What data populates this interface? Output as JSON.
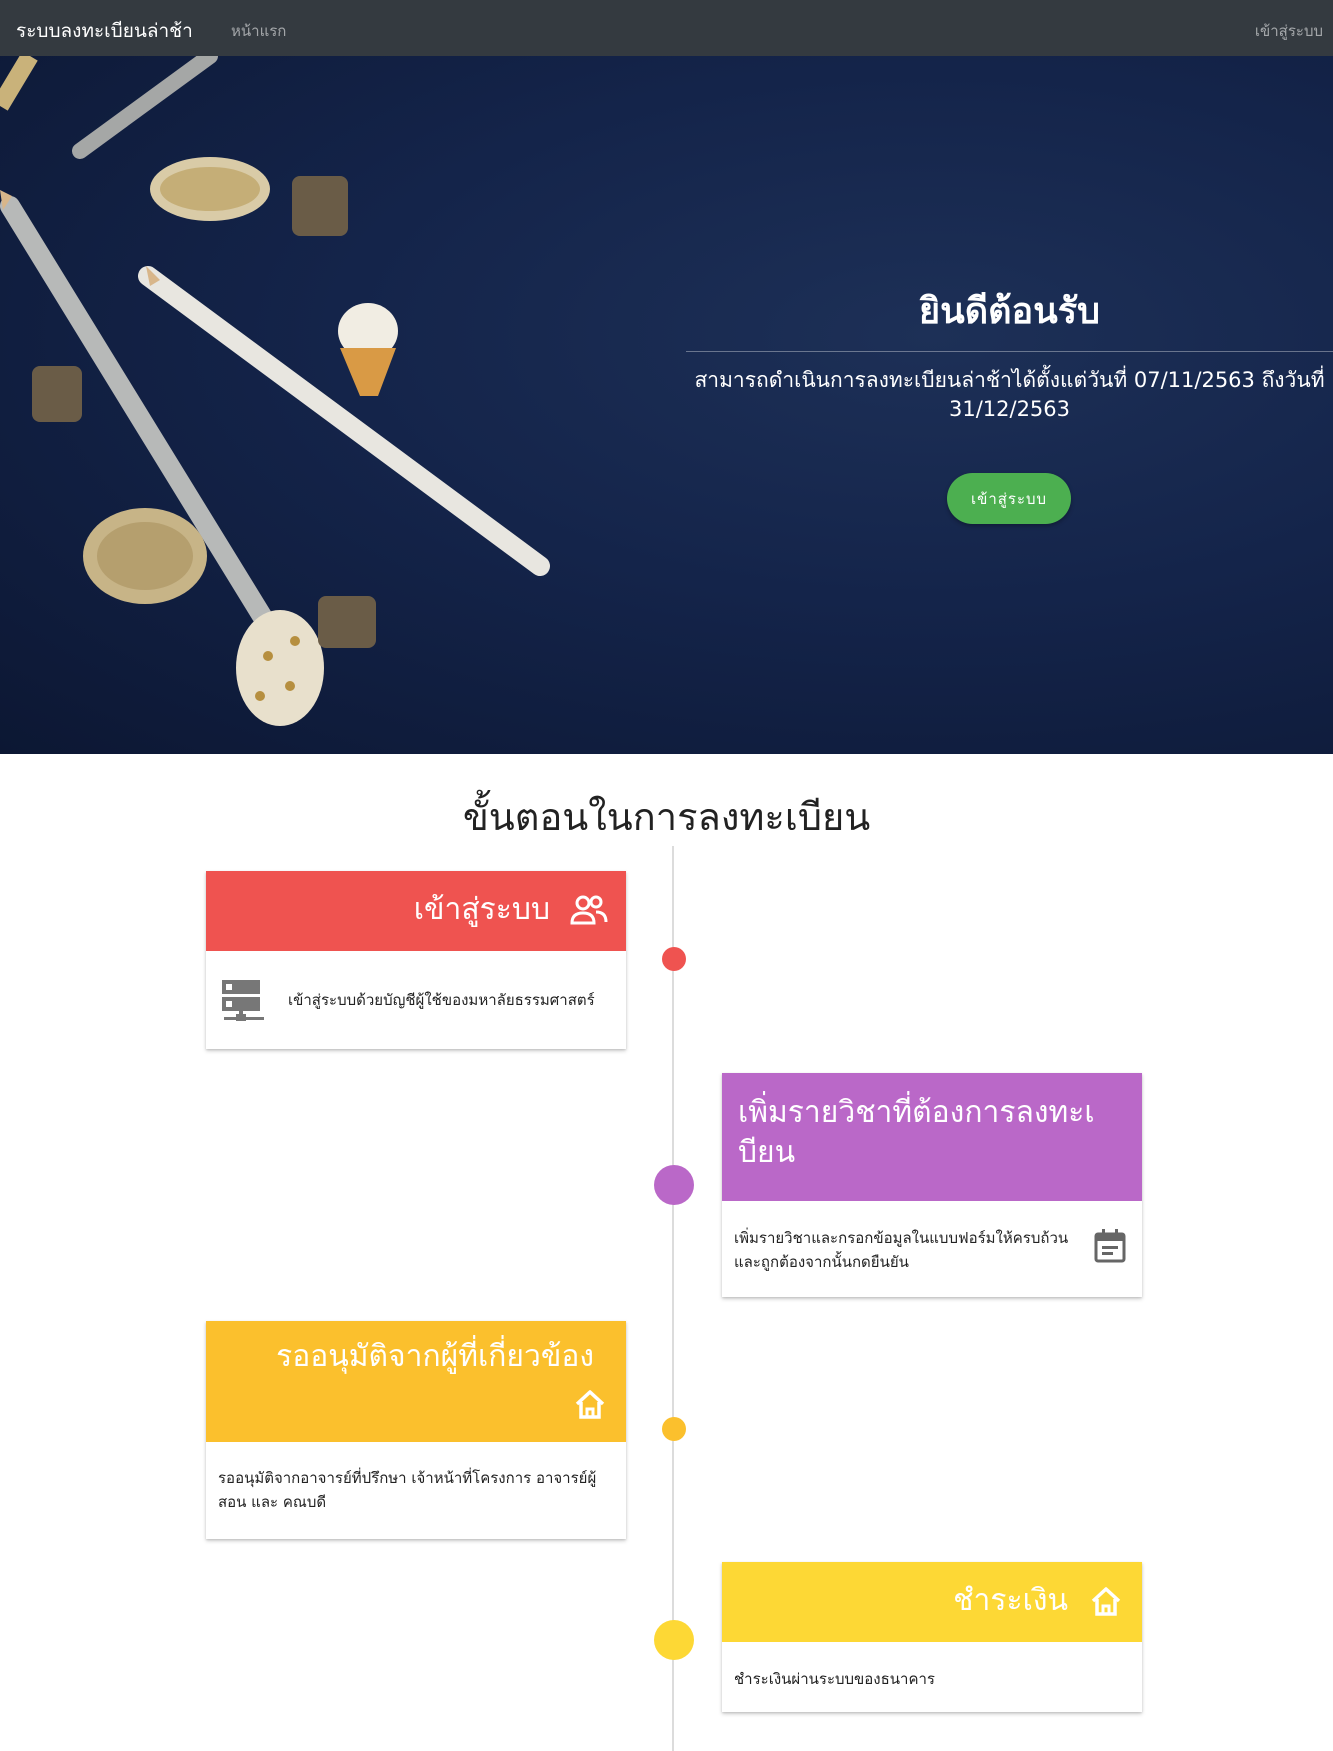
{
  "navbar": {
    "brand": "ระบบลงทะเบียนล่าช้า",
    "home": "หน้าแรก",
    "login": "เข้าสู่ระบบ"
  },
  "hero": {
    "title": "ยินดีต้อนรับ",
    "subtitle_line1": "สามารถดำเนินการลงทะเบียนล่าช้าได้ตั้งแต่วันที่ 07/11/2563 ถึงวันที่",
    "subtitle_line2": "31/12/2563",
    "button": "เข้าสู่ระบบ"
  },
  "steps": {
    "title": "ขั้นตอนในการลงทะเบียน",
    "items": [
      {
        "title": "เข้าสู่ระบบ",
        "icon": "people-icon",
        "body_icon": "server-icon",
        "body": "เข้าสู่ระบบด้วยบัญชีผู้ใช้ของมหาลัยธรรมศาสตร์",
        "color": "#ef5350"
      },
      {
        "title_line1": "เพิ่มรายวิชาที่ต้องการลงทะเ",
        "title_line2": "บียน",
        "body_icon": "calendar-icon",
        "body_line1": "เพิ่มรายวิชาและกรอกข้อมูลในแบบฟอร์มให้ครบถ้วน",
        "body_line2": "และถูกต้องจากนั้นกดยืนยัน",
        "color": "#ba68c8"
      },
      {
        "title": "รออนุมัติจากผู้ที่เกี่ยวข้อง",
        "icon": "home-icon",
        "body_line1": "รออนุมัติจากอาจารย์ที่ปรึกษา เจ้าหน้าที่โครงการ อาจารย์ผู้",
        "body_line2": "สอน และ คณบดี",
        "color": "#fbc02d"
      },
      {
        "title": "ชำระเงิน",
        "icon": "home-icon",
        "body": "ชำระเงินผ่านระบบของธนาคาร",
        "color": "#fdd835"
      }
    ]
  }
}
